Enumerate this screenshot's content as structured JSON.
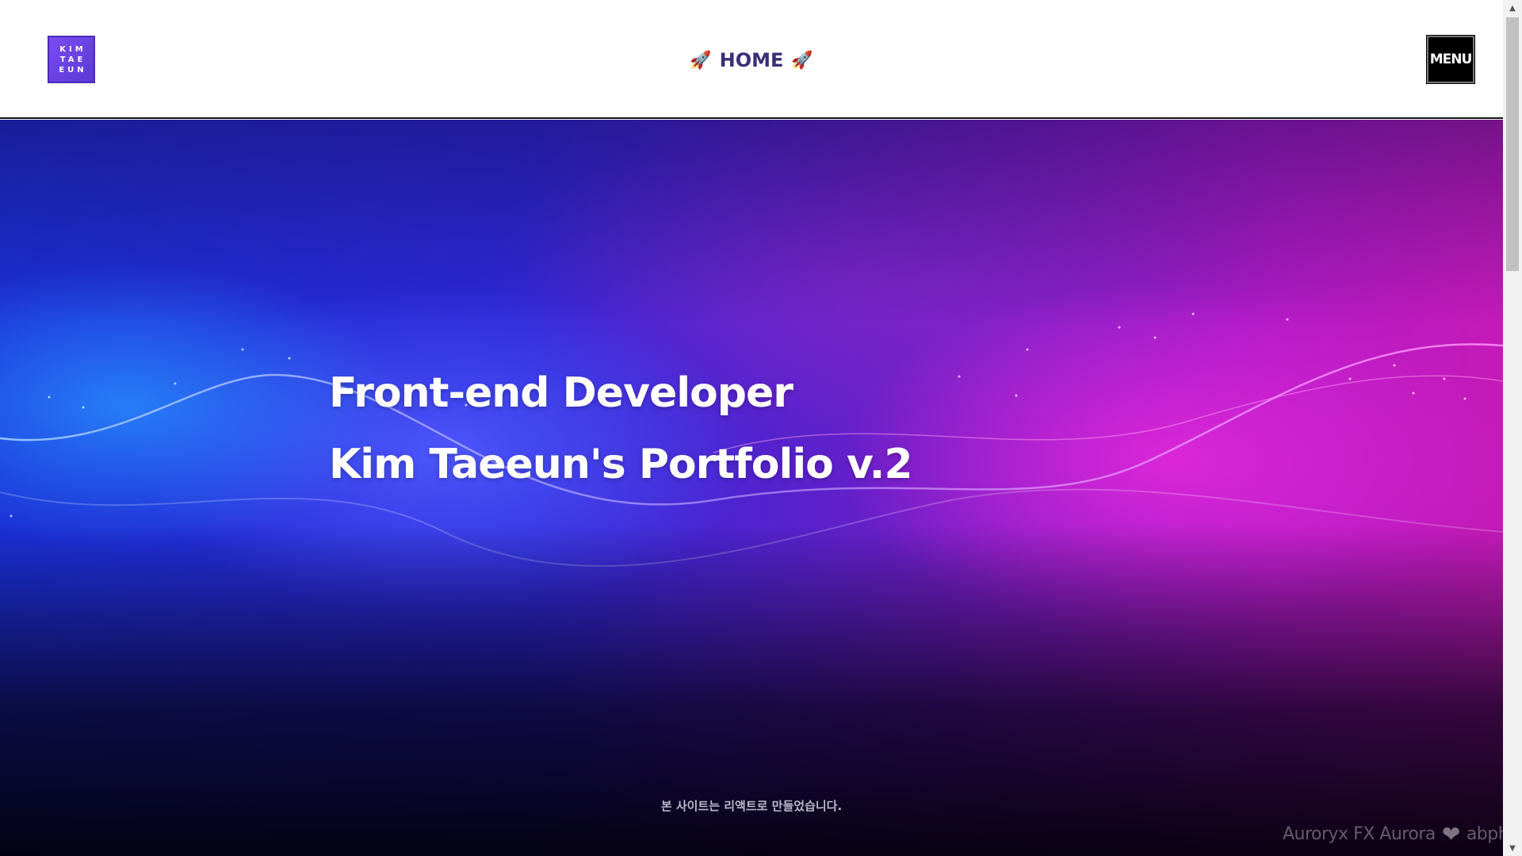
{
  "header": {
    "logo_lines": [
      "KIM",
      "TAE",
      "EUN"
    ],
    "home_label": "HOME",
    "rocket_icon": "🚀",
    "menu_label": "MENU"
  },
  "hero": {
    "headline_line1": "Front-end Developer",
    "headline_line2": "Kim Taeeun's Portfolio v.2",
    "footer_note": "본 사이트는 리액트로 만들었습니다.",
    "watermark_text": "Auroryx FX Aurora",
    "watermark_tail": "abph"
  },
  "colors": {
    "logo": "#7b4cf0",
    "home_text": "#3b2f77",
    "menu_bg": "#000000",
    "hero_blue": "#1b2fd6",
    "hero_magenta": "#c61ab8"
  }
}
